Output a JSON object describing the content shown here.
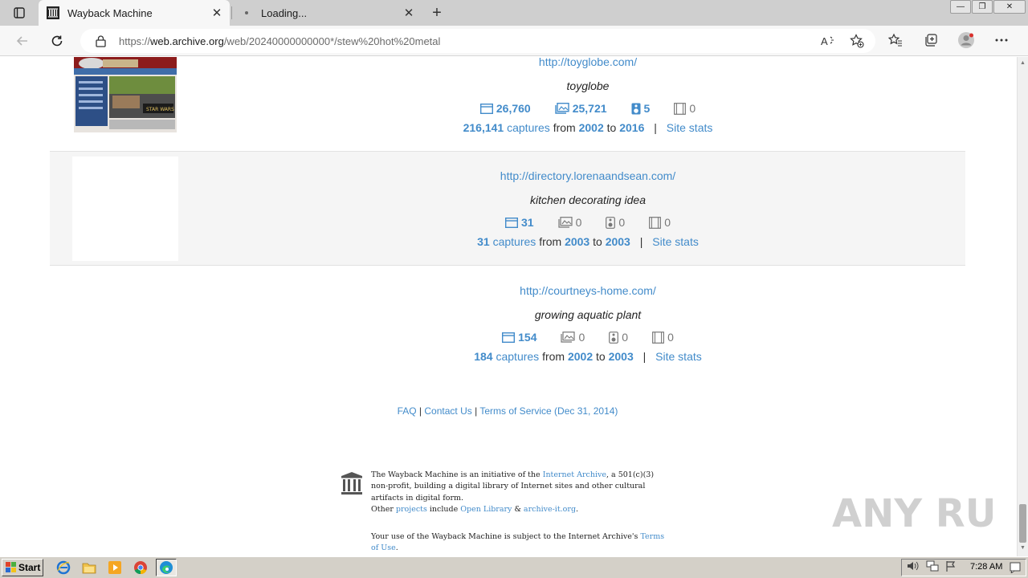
{
  "browser": {
    "tabs": [
      {
        "title": "Wayback Machine",
        "active": true
      },
      {
        "title": "Loading...",
        "active": false
      }
    ],
    "address": {
      "prefix": "https://",
      "host": "web.archive.org",
      "path": "/web/20240000000000*/stew%20hot%20metal"
    }
  },
  "results": [
    {
      "url": "http://toyglobe.com/",
      "description": "toyglobe",
      "stats": {
        "html": "26,760",
        "images": "25,721",
        "audio": "5",
        "video": "0"
      },
      "captures_count": "216,141",
      "captures_word": "captures",
      "from_word": "from",
      "from_year": "2002",
      "to_word": "to",
      "to_year": "2016",
      "site_stats": "Site stats"
    },
    {
      "url": "http://directory.lorenaandsean.com/",
      "description": "kitchen decorating idea",
      "stats": {
        "html": "31",
        "images": "0",
        "audio": "0",
        "video": "0"
      },
      "captures_count": "31",
      "captures_word": "captures",
      "from_word": "from",
      "from_year": "2003",
      "to_word": "to",
      "to_year": "2003",
      "site_stats": "Site stats"
    },
    {
      "url": "http://courtneys-home.com/",
      "description": "growing aquatic plant",
      "stats": {
        "html": "154",
        "images": "0",
        "audio": "0",
        "video": "0"
      },
      "captures_count": "184",
      "captures_word": "captures",
      "from_word": "from",
      "from_year": "2002",
      "to_word": "to",
      "to_year": "2003",
      "site_stats": "Site stats"
    }
  ],
  "footer": {
    "faq": "FAQ",
    "contact": "Contact Us",
    "terms": "Terms of Service (Dec 31, 2014)",
    "separator": "|"
  },
  "about": {
    "line1_a": "The Wayback Machine is an initiative of the ",
    "internet_archive": "Internet Archive",
    "line1_b": ", a 501(c)(3) non-profit, building a digital library of Internet sites and other cultural artifacts in digital form.",
    "other": "Other ",
    "projects": "projects",
    "include": " include ",
    "open_library": "Open Library",
    "amp": " & ",
    "archive_it": "archive-it.org",
    "period": ".",
    "use_a": "Your use of the Wayback Machine is subject to the Internet Archive's ",
    "terms_of_use": "Terms of Use",
    "use_b": "."
  },
  "watermark": "ANY RUN",
  "taskbar": {
    "start": "Start",
    "clock": "7:28 AM"
  },
  "colors": {
    "link": "#428bca",
    "taskbar": "#d4d0c8",
    "tabbar": "#cfcfcf"
  }
}
